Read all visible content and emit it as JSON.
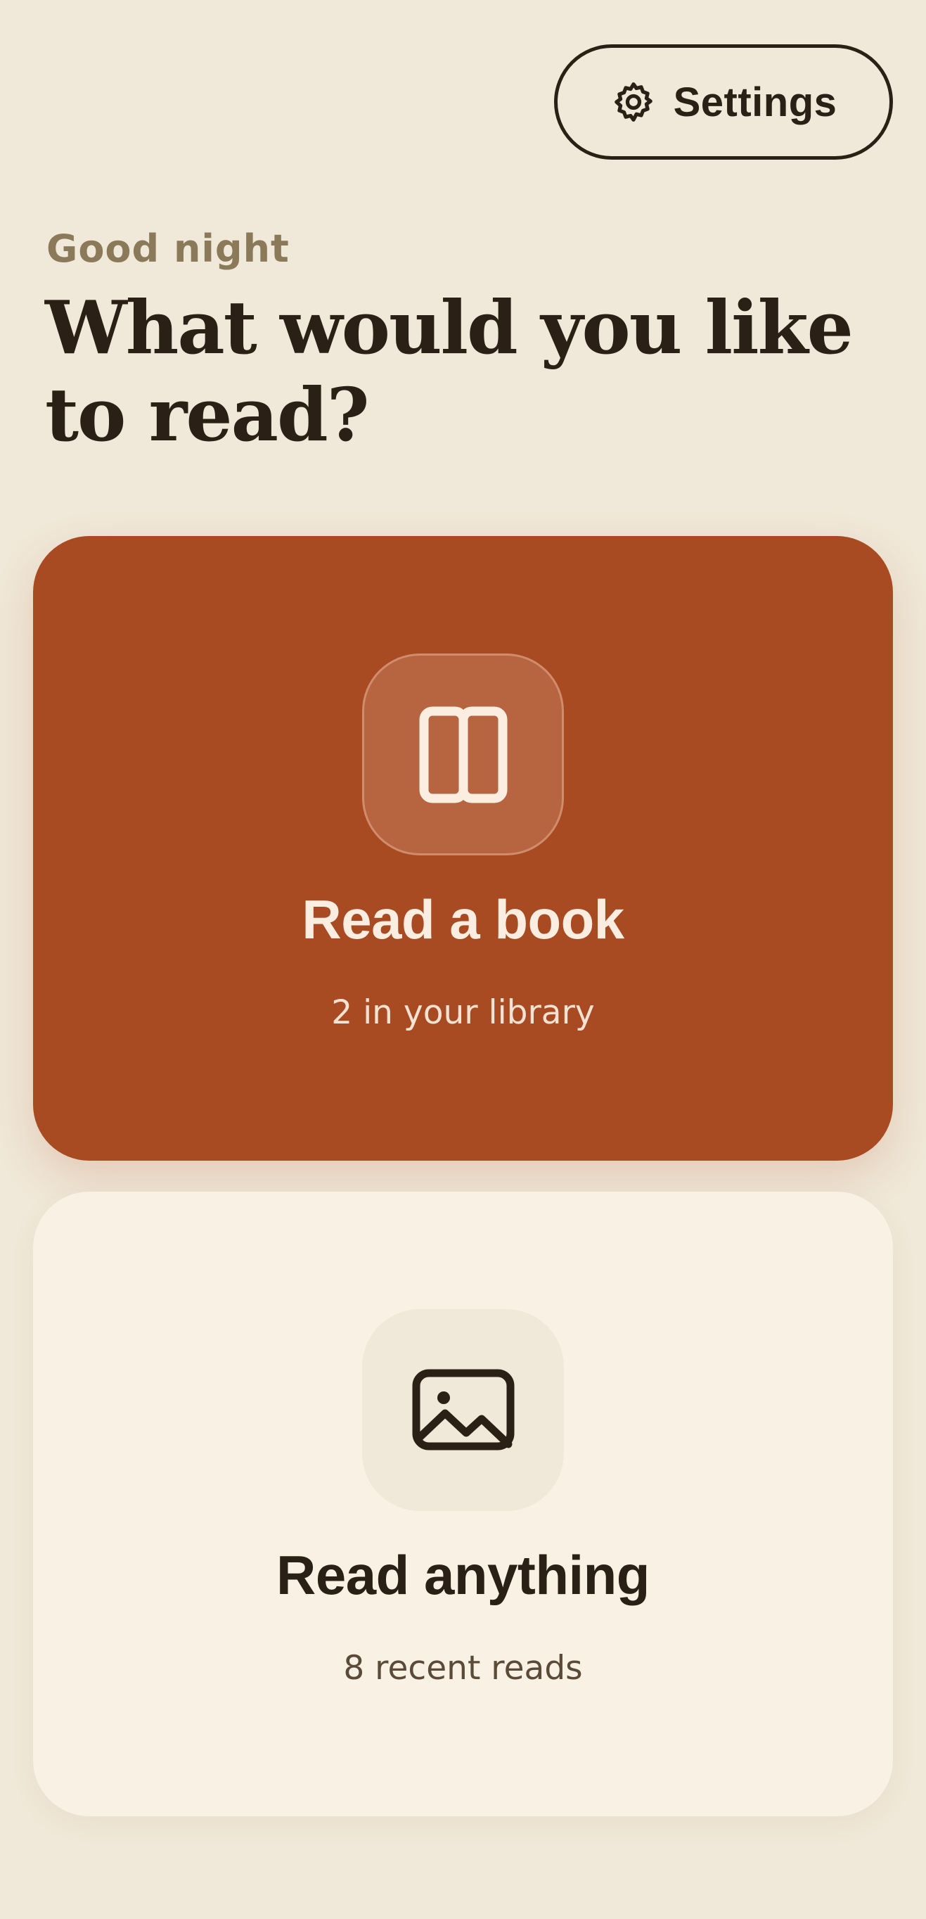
{
  "header": {
    "settings_label": "Settings",
    "settings_icon": "gear-icon"
  },
  "hero": {
    "greeting": "Good night",
    "title": "What would you like to read?"
  },
  "cards": [
    {
      "title": "Read a book",
      "subtitle": "2 in your library",
      "icon": "book-icon",
      "background": "#a84a22",
      "text_color": "#fbeee0"
    },
    {
      "title": "Read anything",
      "subtitle": "8 recent reads",
      "icon": "image-icon",
      "background": "#f8f1e4",
      "text_color": "#2a2016"
    }
  ],
  "colors": {
    "page_background": "#f0e8d8",
    "accent": "#a84a22",
    "ink": "#2a2016",
    "muted": "#8b7a5a"
  }
}
